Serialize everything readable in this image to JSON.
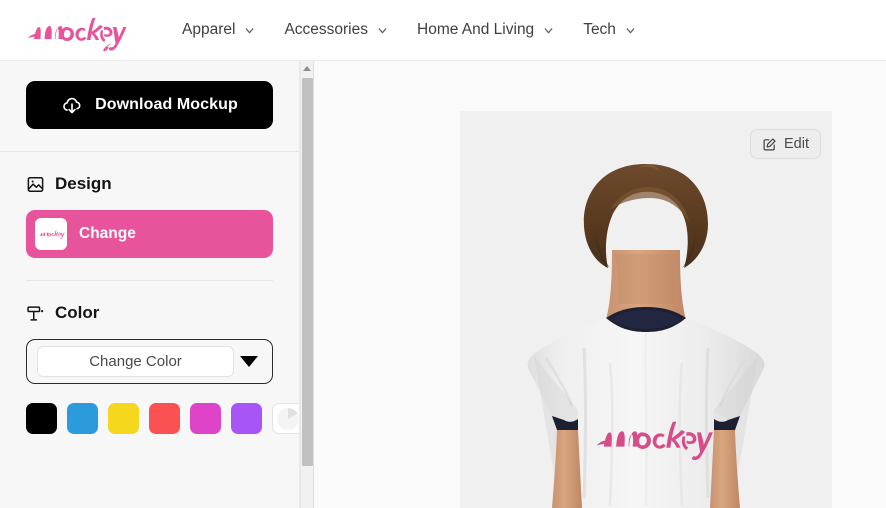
{
  "brand": {
    "logo_text": "mockey",
    "logo_color": "#e8549b"
  },
  "header": {
    "nav": [
      {
        "label": "Apparel",
        "icon": "chevron-down-icon"
      },
      {
        "label": "Accessories",
        "icon": "chevron-down-icon"
      },
      {
        "label": "Home And Living",
        "icon": "chevron-down-icon"
      },
      {
        "label": "Tech",
        "icon": "chevron-down-icon"
      }
    ]
  },
  "sidebar": {
    "download_button": {
      "label": "Download Mockup",
      "icon": "cloud-download-icon",
      "background": "#000000",
      "text_color": "#ffffff"
    },
    "design_section": {
      "title": "Design",
      "icon": "image-icon",
      "change_button": {
        "label": "Change",
        "thumbnail_alt": "mockey",
        "background": "#e8549b"
      }
    },
    "color_section": {
      "title": "Color",
      "icon": "paint-roller-icon",
      "select": {
        "value": "Change Color",
        "placeholder": "Change Color",
        "caret_icon": "caret-down-icon"
      },
      "swatches": [
        {
          "name": "black",
          "hex": "#000000"
        },
        {
          "name": "blue",
          "hex": "#2c9bdb"
        },
        {
          "name": "yellow",
          "hex": "#f5d81e"
        },
        {
          "name": "red",
          "hex": "#fa5252"
        },
        {
          "name": "magenta",
          "hex": "#dd44c8"
        },
        {
          "name": "purple",
          "hex": "#a855f7"
        },
        {
          "name": "white",
          "hex": "#ffffff"
        }
      ]
    }
  },
  "scrollbar": {
    "up_arrow_icon": "scroll-up-arrow-icon",
    "orientation": "vertical"
  },
  "canvas": {
    "edit_button": {
      "label": "Edit",
      "icon": "edit-square-pencil-icon"
    },
    "background": "#f0f0f0",
    "mockup": {
      "alt": "person seen from behind wearing a white ringer t-shirt with mockey print",
      "shirt_color": "#f2f2f2",
      "trim_color": "#1d2033",
      "print_text": "mockey",
      "print_color": "#d33f80"
    }
  }
}
